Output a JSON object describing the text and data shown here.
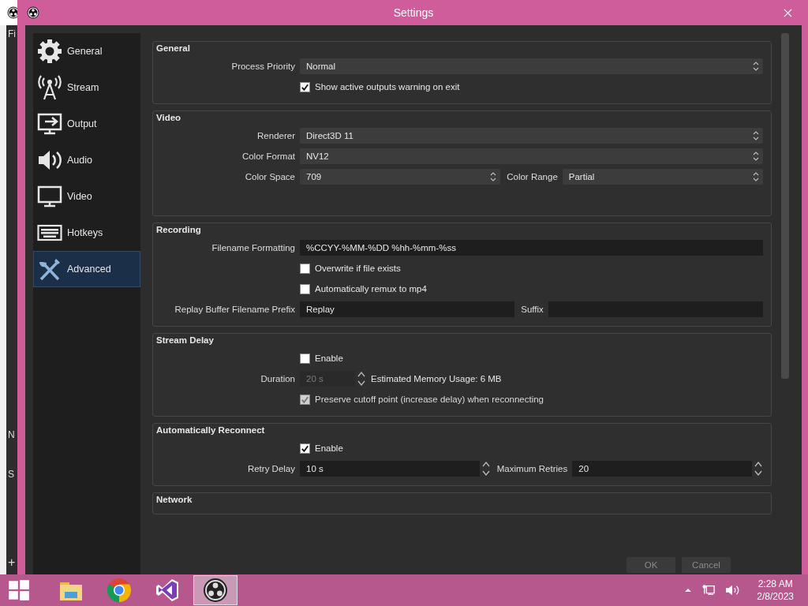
{
  "background_window": {
    "texts": [
      "Fi",
      "N",
      "S",
      "+"
    ]
  },
  "window": {
    "title": "Settings"
  },
  "sidebar": {
    "items": [
      {
        "label": "General",
        "selected": false
      },
      {
        "label": "Stream",
        "selected": false
      },
      {
        "label": "Output",
        "selected": false
      },
      {
        "label": "Audio",
        "selected": false
      },
      {
        "label": "Video",
        "selected": false
      },
      {
        "label": "Hotkeys",
        "selected": false
      },
      {
        "label": "Advanced",
        "selected": true
      }
    ]
  },
  "sections": [
    {
      "title": "General",
      "rows": [
        {
          "kind": "fields",
          "fields": [
            {
              "kind": "combo",
              "label": "Process Priority",
              "value": "Normal",
              "disabled": false
            }
          ]
        },
        {
          "kind": "checkbox",
          "label": "Show active outputs warning on exit",
          "checked": true,
          "disabled": false
        }
      ]
    },
    {
      "title": "Video",
      "rows": [
        {
          "kind": "fields",
          "fields": [
            {
              "kind": "combo",
              "label": "Renderer",
              "value": "Direct3D 11",
              "disabled": false
            }
          ]
        },
        {
          "kind": "fields",
          "fields": [
            {
              "kind": "combo",
              "label": "Color Format",
              "value": "NV12",
              "disabled": false
            }
          ]
        },
        {
          "kind": "fields",
          "fields": [
            {
              "kind": "combo",
              "label": "Color Space",
              "value": "709",
              "disabled": false
            },
            {
              "kind": "combo",
              "label": "Color Range",
              "value": "Partial",
              "disabled": false
            }
          ]
        }
      ]
    },
    {
      "title": "Recording",
      "rows": [
        {
          "kind": "fields",
          "fields": [
            {
              "kind": "text",
              "label": "Filename Formatting",
              "value": "%CCYY-%MM-%DD %hh-%mm-%ss",
              "disabled": false
            }
          ]
        },
        {
          "kind": "checkbox",
          "label": "Overwrite if file exists",
          "checked": false,
          "disabled": false
        },
        {
          "kind": "checkbox",
          "label": "Automatically remux to mp4",
          "checked": false,
          "disabled": false
        },
        {
          "kind": "fields",
          "fields": [
            {
              "kind": "text",
              "label": "Replay Buffer Filename Prefix",
              "value": "Replay",
              "disabled": false
            },
            {
              "kind": "text",
              "label": "Suffix",
              "disabled": false
            }
          ]
        }
      ]
    },
    {
      "title": "Stream Delay",
      "rows": [
        {
          "kind": "checkbox",
          "label": "Enable",
          "checked": false,
          "disabled": false
        },
        {
          "kind": "fields",
          "fields": [
            {
              "kind": "spin",
              "label": "Duration",
              "value": "20 s",
              "disabled": true
            },
            {
              "kind": "note",
              "value": "Estimated Memory Usage: 6 MB"
            }
          ]
        },
        {
          "kind": "checkbox",
          "label": "Preserve cutoff point (increase delay) when reconnecting",
          "checked": true,
          "disabled": true
        }
      ]
    },
    {
      "title": "Automatically Reconnect",
      "rows": [
        {
          "kind": "checkbox",
          "label": "Enable",
          "checked": true,
          "disabled": false
        },
        {
          "kind": "fields",
          "fields": [
            {
              "kind": "spin",
              "label": "Retry Delay",
              "value": "10 s",
              "disabled": false
            },
            {
              "kind": "spin",
              "label": "Maximum Retries",
              "value": "20",
              "disabled": false
            }
          ]
        }
      ]
    },
    {
      "title": "Network"
    }
  ],
  "buttons": [
    "OK",
    "Cancel"
  ],
  "taskbar": {
    "apps": [
      {
        "selected": false
      },
      {
        "selected": false
      },
      {
        "selected": false
      },
      {
        "selected": true
      }
    ],
    "time": "2:28 AM",
    "date": "2/8/2023"
  }
}
